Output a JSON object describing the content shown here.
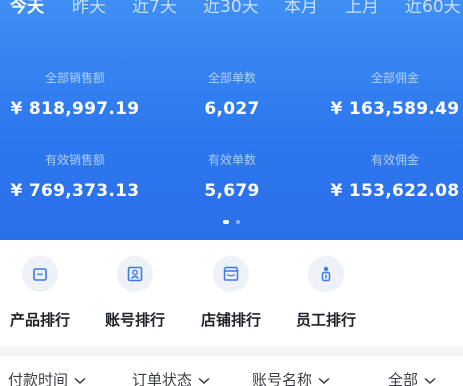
{
  "tabs": [
    {
      "label": "今天"
    },
    {
      "label": "昨天"
    },
    {
      "label": "近7天"
    },
    {
      "label": "近30天"
    },
    {
      "label": "本月"
    },
    {
      "label": "上月"
    },
    {
      "label": "近60天"
    }
  ],
  "stats": {
    "total_sales": {
      "label": "全部销售额",
      "value": "¥ 818,997.19"
    },
    "total_orders": {
      "label": "全部单数",
      "value": "6,027"
    },
    "total_commission": {
      "label": "全部佣金",
      "value": "¥ 163,589.49"
    },
    "valid_sales": {
      "label": "有效销售额",
      "value": "¥ 769,373.13"
    },
    "valid_orders": {
      "label": "有效单数",
      "value": "5,679"
    },
    "valid_commission": {
      "label": "有效佣金",
      "value": "¥ 153,622.08"
    }
  },
  "shortcuts": [
    {
      "label": "产品排行",
      "icon": "product-bag-icon"
    },
    {
      "label": "账号排行",
      "icon": "account-card-icon"
    },
    {
      "label": "店铺排行",
      "icon": "store-icon"
    },
    {
      "label": "员工排行",
      "icon": "employee-icon"
    }
  ],
  "filters": [
    {
      "label": "付款时间"
    },
    {
      "label": "订单状态"
    },
    {
      "label": "账号名称"
    },
    {
      "label": "全部"
    }
  ],
  "colors": {
    "hero_top": "#3f8ff4",
    "hero_bottom": "#2a6fe9",
    "icon_blue": "#3a7bf0",
    "icon_bg": "#eef2f8"
  }
}
